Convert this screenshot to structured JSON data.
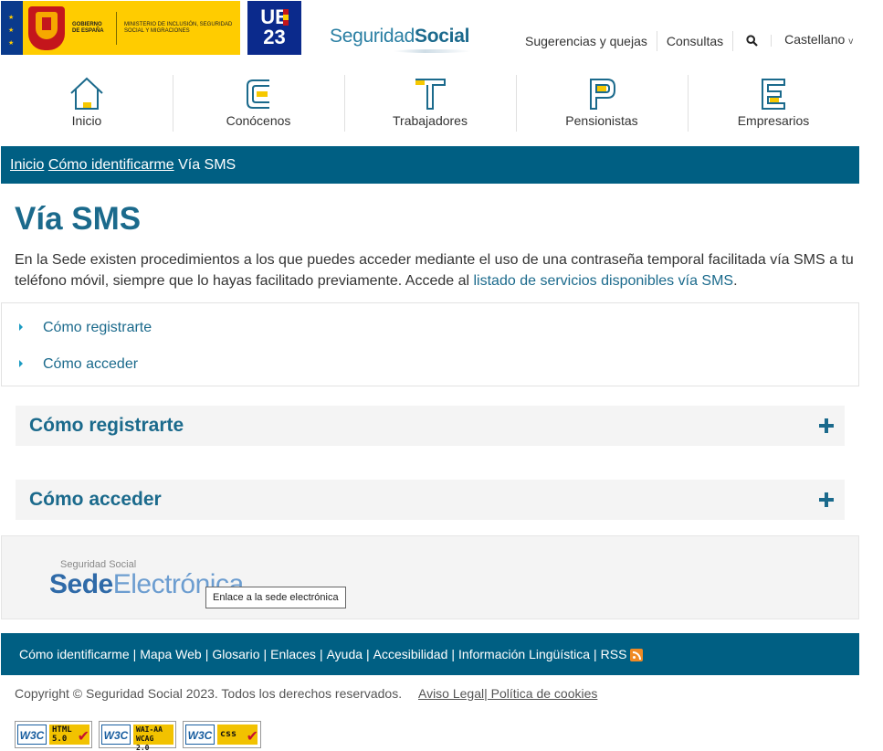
{
  "header": {
    "gov_text": "GOBIERNO DE ESPAÑA",
    "ministry_text": "MINISTERIO DE INCLUSIÓN, SEGURIDAD SOCIAL Y MIGRACIONES",
    "ue_top": "UE",
    "ue_bottom": "23",
    "ss_light": "Seguridad",
    "ss_bold": "Social",
    "links": {
      "suggestions": "Sugerencias y quejas",
      "queries": "Consultas",
      "language": "Castellano",
      "language_chevron": "v"
    }
  },
  "nav": {
    "items": [
      {
        "label": "Inicio",
        "icon": "home-icon"
      },
      {
        "label": "Conócenos",
        "icon": "letter-c-icon"
      },
      {
        "label": "Trabajadores",
        "icon": "letter-t-icon"
      },
      {
        "label": "Pensionistas",
        "icon": "letter-p-icon"
      },
      {
        "label": "Empresarios",
        "icon": "letter-e-icon"
      }
    ]
  },
  "breadcrumb": {
    "home": "Inicio",
    "parent": "Cómo identificarme",
    "current": "Vía SMS"
  },
  "main": {
    "title": "Vía SMS",
    "intro_text": "En la Sede existen procedimientos a los que puedes acceder mediante el uso de una contraseña temporal facilitada vía SMS a tu teléfono móvil, siempre que lo hayas facilitado previamente. Accede al ",
    "intro_link": "listado de servicios disponibles vía SMS",
    "intro_end": ".",
    "toc": [
      "Cómo registrarte",
      "Cómo acceder"
    ],
    "accordions": [
      "Cómo registrarte",
      "Cómo acceder"
    ]
  },
  "sede": {
    "small": "Seguridad Social",
    "big_bold": "Sede",
    "big_light": "Electrónica",
    "tooltip": "Enlace a la sede electrónica"
  },
  "footer": {
    "links": [
      "Cómo identificarme",
      "Mapa Web",
      "Glosario",
      "Enlaces",
      "Ayuda",
      "Accesibilidad",
      "Información Lingüística",
      "RSS"
    ],
    "separator": "|",
    "copyright": "Copyright © Seguridad Social 2023. Todos los derechos reservados.",
    "legal": "Aviso Legal",
    "cookies": "| Política de cookies",
    "badges": [
      {
        "w3c": "W3C",
        "line1": "HTML",
        "line2": "5.0"
      },
      {
        "w3c": "W3C",
        "line1": "WAI-AA",
        "line2": "WCAG 2.0"
      },
      {
        "w3c": "W3C",
        "line1": "css",
        "line2": ""
      }
    ]
  },
  "colors": {
    "brand_blue": "#005f83",
    "title_blue": "#1b6a8c",
    "accent_yellow": "#f6c800"
  }
}
